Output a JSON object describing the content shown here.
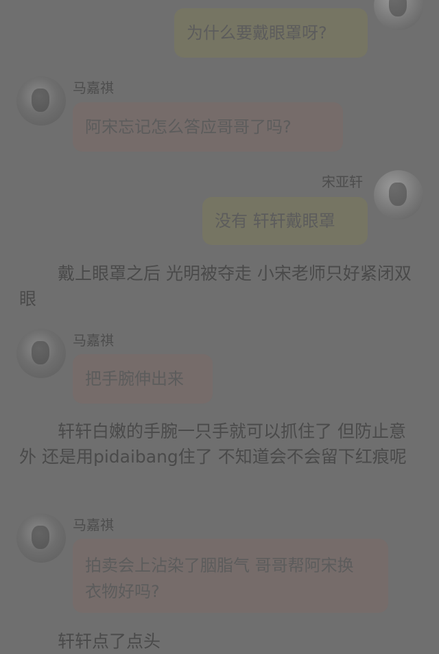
{
  "messages": [
    {
      "id": "m1",
      "side": "right",
      "text": "为什么要戴眼罩呀?"
    },
    {
      "id": "m2",
      "side": "left",
      "sender": "马嘉祺",
      "text": "阿宋忘记怎么答应哥哥了吗?"
    },
    {
      "id": "m3",
      "side": "right",
      "sender": "宋亚轩",
      "text": "没有 轩轩戴眼罩"
    },
    {
      "id": "n1",
      "type": "narration",
      "text": "戴上眼罩之后 光明被夺走 小宋老师只好紧闭双眼"
    },
    {
      "id": "m4",
      "side": "left",
      "sender": "马嘉祺",
      "text": "把手腕伸出来"
    },
    {
      "id": "n2",
      "type": "narration",
      "text": "轩轩白嫩的手腕一只手就可以抓住了 但防止意外 还是用pidaibang住了 不知道会不会留下红痕呢"
    },
    {
      "id": "m5",
      "side": "left",
      "sender": "马嘉祺",
      "text": "拍卖会上沾染了胭脂气 哥哥帮阿宋换衣物好吗?"
    },
    {
      "id": "n3",
      "type": "narration",
      "text": "轩轩点了点头"
    }
  ]
}
